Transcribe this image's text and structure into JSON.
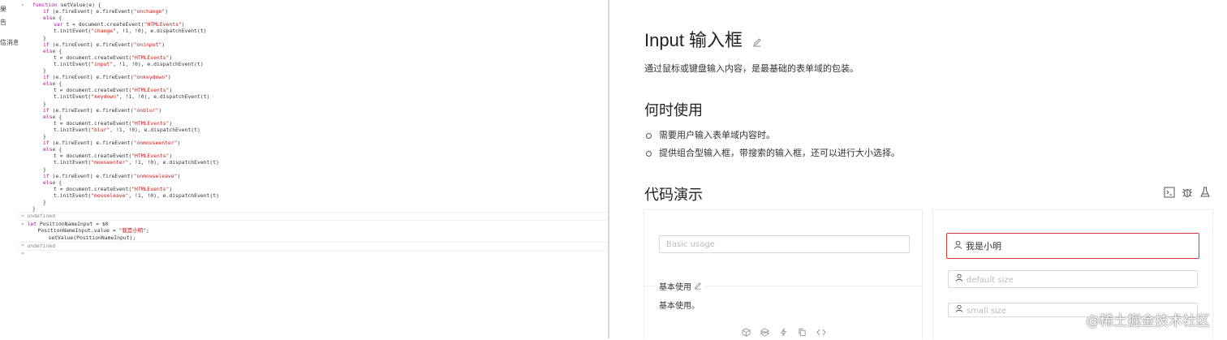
{
  "devtools": {
    "sidebar_labels": [
      "果",
      "告",
      "信消息"
    ],
    "code_lines": [
      {
        "t": "function setValue(e) {",
        "i": 2,
        "g": ">"
      },
      {
        "t": "if (e.fireEvent) e.fireEvent(\"onchange\")",
        "i": 4
      },
      {
        "t": "else {",
        "i": 4
      },
      {
        "t": "var t = document.createEvent(\"HTMLEvents\")",
        "i": 6
      },
      {
        "t": "t.initEvent(\"change\", !1, !0), e.dispatchEvent(t)",
        "i": 6
      },
      {
        "t": "}",
        "i": 4
      },
      {
        "t": "if (e.fireEvent) e.fireEvent(\"oninput\")",
        "i": 4
      },
      {
        "t": "else {",
        "i": 4
      },
      {
        "t": "t = document.createEvent(\"HTMLEvents\")",
        "i": 6
      },
      {
        "t": "t.initEvent(\"input\", !1, !0), e.dispatchEvent(t)",
        "i": 6
      },
      {
        "t": "}",
        "i": 4
      },
      {
        "t": "if (e.fireEvent) e.fireEvent(\"onkeydown\")",
        "i": 4
      },
      {
        "t": "else {",
        "i": 4
      },
      {
        "t": "t = document.createEvent(\"HTMLEvents\")",
        "i": 6
      },
      {
        "t": "t.initEvent(\"keydown\", !1, !0), e.dispatchEvent(t)",
        "i": 6
      },
      {
        "t": "}",
        "i": 4
      },
      {
        "t": "if (e.fireEvent) e.fireEvent(\"onblur\")",
        "i": 4
      },
      {
        "t": "else {",
        "i": 4
      },
      {
        "t": "t = document.createEvent(\"HTMLEvents\")",
        "i": 6
      },
      {
        "t": "t.initEvent(\"blur\", !1, !0), e.dispatchEvent(t)",
        "i": 6
      },
      {
        "t": "}",
        "i": 4
      },
      {
        "t": "if (e.fireEvent) e.fireEvent(\"onmouseenter\")",
        "i": 4
      },
      {
        "t": "else {",
        "i": 4
      },
      {
        "t": "t = document.createEvent(\"HTMLEvents\")",
        "i": 6
      },
      {
        "t": "t.initEvent(\"mouseenter\", !1, !0), e.dispatchEvent(t)",
        "i": 6
      },
      {
        "t": "}",
        "i": 4
      },
      {
        "t": "if (e.fireEvent) e.fireEvent(\"onmouseleave\")",
        "i": 4
      },
      {
        "t": "else {",
        "i": 4
      },
      {
        "t": "t = document.createEvent(\"HTMLEvents\")",
        "i": 6
      },
      {
        "t": "t.initEvent(\"mouseleave\", !1, !0), e.dispatchEvent(t)",
        "i": 6
      },
      {
        "t": "}",
        "i": 4
      },
      {
        "t": "}",
        "i": 2
      },
      {
        "t": "undefined",
        "i": 1,
        "g": "<",
        "muted": true
      },
      {
        "t": "let PositionNameInput = $0",
        "i": 1,
        "g": ">"
      },
      {
        "t": "PositionNameInput.value = \"我是小明\";",
        "i": 3
      },
      {
        "t": "setValue(PositionNameInput);",
        "i": 5
      },
      {
        "t": "undefined",
        "i": 1,
        "g": "<",
        "muted": true
      },
      {
        "t": "",
        "i": 1,
        "g": ">"
      }
    ]
  },
  "doc": {
    "title": "Input  输入框",
    "intro": "通过鼠标或键盘输入内容，是最基础的表单域的包装。",
    "when_title": "何时使用",
    "when_items": [
      "需要用户输入表单域内容时。",
      "提供组合型输入框，带搜索的输入框，还可以进行大小选择。"
    ],
    "demo_title": "代码演示",
    "demo_basic": {
      "placeholder": "Basic usage",
      "meta_title": "基本使用",
      "meta_desc": "基本使用。"
    },
    "demo_size": {
      "focused_value": "我是小明",
      "default_placeholder": "default size",
      "small_placeholder": "small size"
    }
  },
  "watermark": "@稀土掘金技术社区",
  "colors": {
    "focus_border": "#d9363e",
    "string": "#c41a16",
    "keyword": "#aa0d91"
  }
}
